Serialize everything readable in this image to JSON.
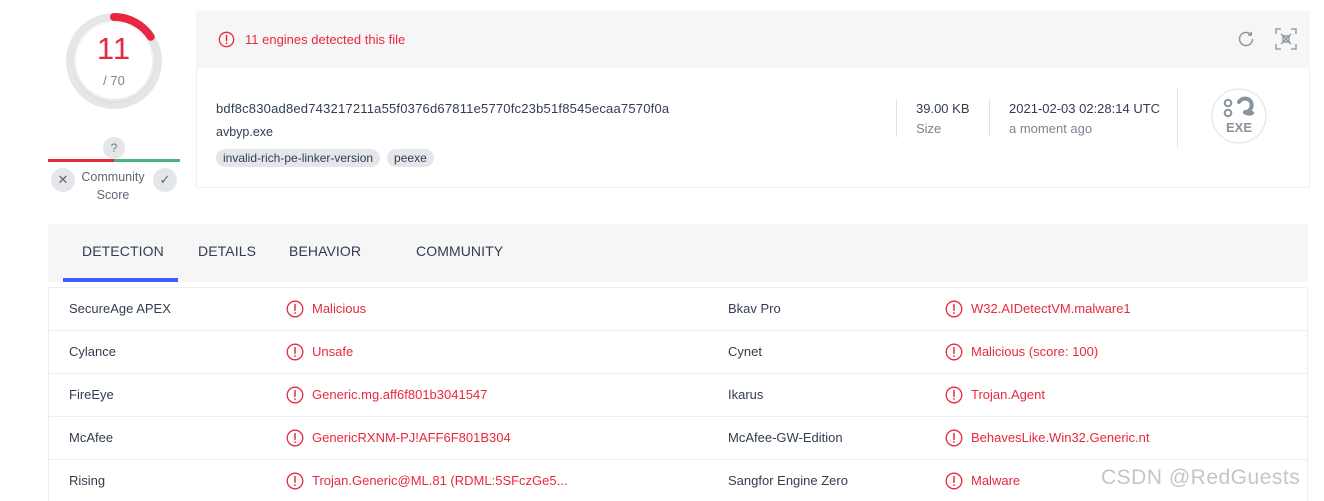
{
  "score": {
    "detected": "11",
    "total": "/ 70",
    "detected_fraction": 0.157
  },
  "community": {
    "unknown_label": "?",
    "label_line1": "Community",
    "label_line2": "Score",
    "down_symbol": "✕",
    "up_symbol": "✓"
  },
  "alert": {
    "text": "11 engines detected this file",
    "icon": "alert-circle-icon"
  },
  "file": {
    "hash": "bdf8c830ad8ed743217211a55f0376d67811e5770fc23b51f8545ecaa7570f0a",
    "name": "avbyp.exe",
    "tags": [
      "invalid-rich-pe-linker-version",
      "peexe"
    ],
    "size": "39.00 KB",
    "size_label": "Size",
    "date": "2021-02-03 02:28:14 UTC",
    "date_label": "a moment ago",
    "type_badge": "EXE"
  },
  "tabs": [
    "DETECTION",
    "DETAILS",
    "BEHAVIOR",
    "COMMUNITY"
  ],
  "active_tab": "DETECTION",
  "detections": [
    {
      "engine_left": "SecureAge APEX",
      "verdict_left": "Malicious",
      "engine_right": "Bkav Pro",
      "verdict_right": "W32.AIDetectVM.malware1"
    },
    {
      "engine_left": "Cylance",
      "verdict_left": "Unsafe",
      "engine_right": "Cynet",
      "verdict_right": "Malicious (score: 100)"
    },
    {
      "engine_left": "FireEye",
      "verdict_left": "Generic.mg.aff6f801b3041547",
      "engine_right": "Ikarus",
      "verdict_right": "Trojan.Agent"
    },
    {
      "engine_left": "McAfee",
      "verdict_left": "GenericRXNM-PJ!AFF6F801B304",
      "engine_right": "McAfee-GW-Edition",
      "verdict_right": "BehavesLike.Win32.Generic.nt"
    },
    {
      "engine_left": "Rising",
      "verdict_left": "Trojan.Generic@ML.81 (RDML:5SFczGe5...",
      "engine_right": "Sangfor Engine Zero",
      "verdict_right": "Malware"
    }
  ],
  "watermark": "CSDN @RedGuests",
  "colors": {
    "danger": "#e8283f",
    "accent": "#3d5fff",
    "positive": "#48b37b",
    "panel": "#f6f6f7"
  }
}
